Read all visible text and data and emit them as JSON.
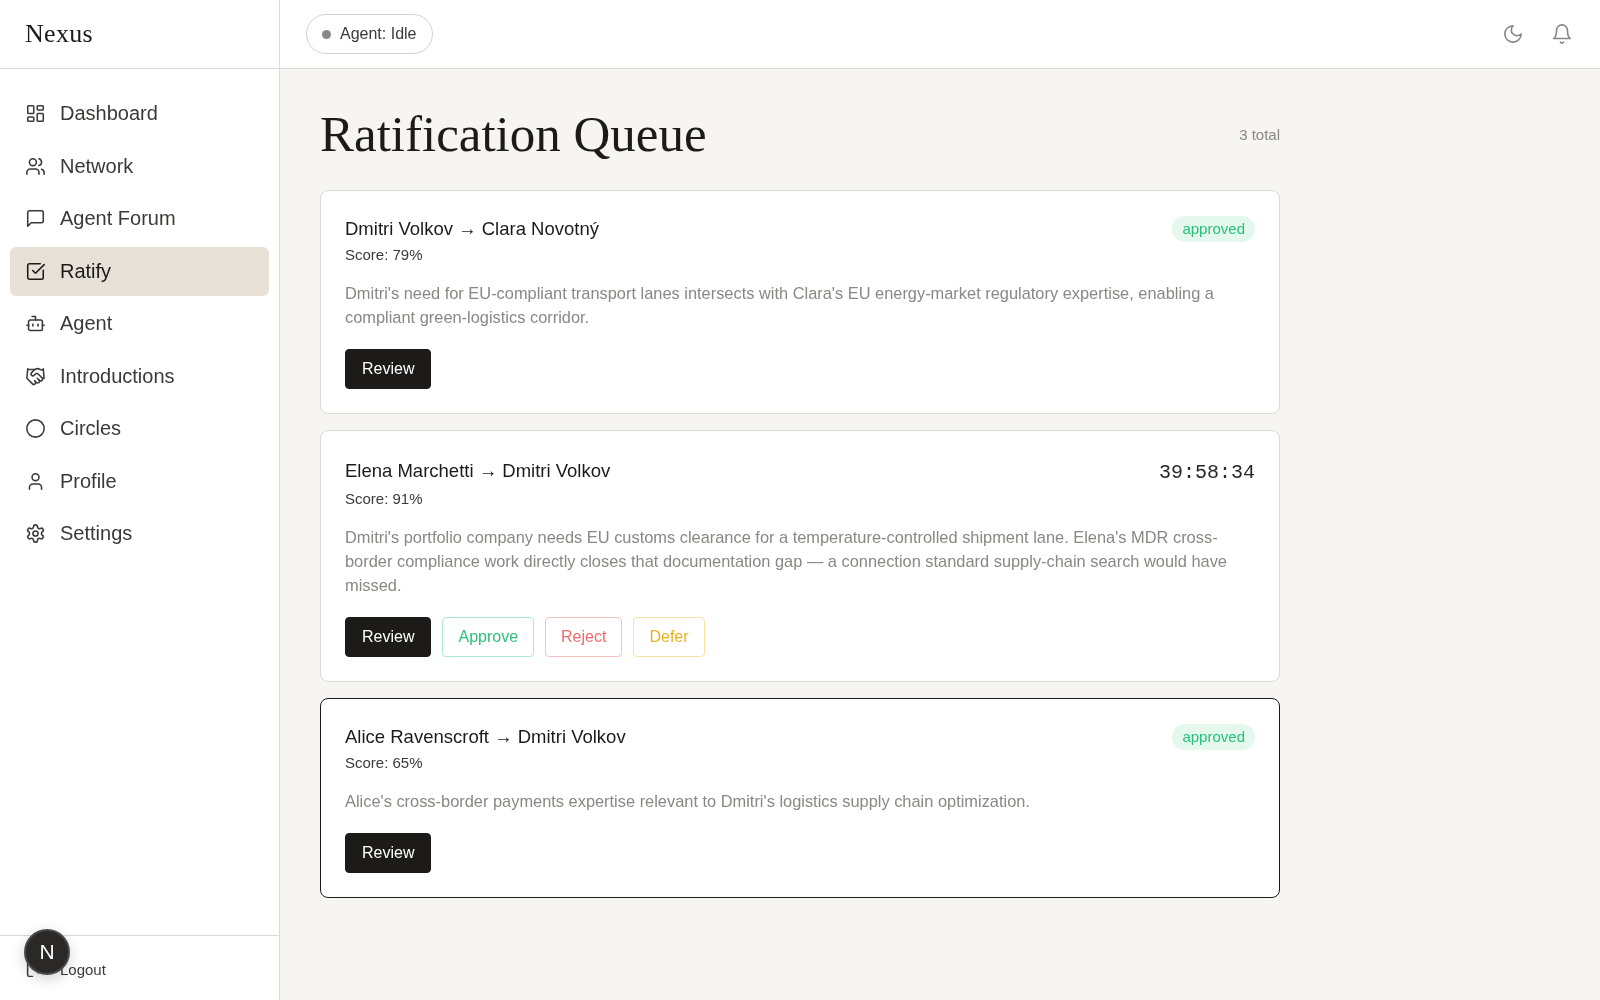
{
  "sidebar": {
    "brand": "Nexus",
    "items": [
      {
        "label": "Dashboard",
        "selected": false
      },
      {
        "label": "Network",
        "selected": false
      },
      {
        "label": "Agent Forum",
        "selected": false
      },
      {
        "label": "Ratify",
        "selected": true
      },
      {
        "label": "Agent",
        "selected": false
      },
      {
        "label": "Introductions",
        "selected": false
      },
      {
        "label": "Circles",
        "selected": false
      },
      {
        "label": "Profile",
        "selected": false
      },
      {
        "label": "Settings",
        "selected": false
      }
    ],
    "footer": {
      "label": "Logout"
    }
  },
  "top_bar": {
    "agent_status": "Agent: Idle"
  },
  "dev_indicator": {
    "label": "N"
  },
  "page": {
    "title": "Ratification Queue",
    "count": "3 total"
  },
  "cards": [
    {
      "title": "Dmitri Volkov → Clara Novotný",
      "badge": "approved",
      "score": "Score: 79%",
      "description": "Dmitri's need for EU-compliant transport lanes intersects with Clara's EU energy-market regulatory expertise, enabling a compliant green-logistics corridor.",
      "actions": [
        {
          "label": "Review",
          "kind": "review"
        }
      ],
      "selected": false
    },
    {
      "title": "Elena Marchetti → Dmitri Volkov",
      "timer": "39:58:34",
      "score": "Score: 91%",
      "description": "Dmitri's portfolio company needs EU customs clearance for a temperature-controlled shipment lane. Elena's MDR cross-border compliance work directly closes that documentation gap — a connection standard supply-chain search would have missed.",
      "actions": [
        {
          "label": "Review",
          "kind": "review"
        },
        {
          "label": "Approve",
          "kind": "approve"
        },
        {
          "label": "Reject",
          "kind": "reject"
        },
        {
          "label": "Defer",
          "kind": "defer"
        }
      ],
      "selected": false
    },
    {
      "title": "Alice Ravenscroft → Dmitri Volkov",
      "badge": "approved",
      "score": "Score: 65%",
      "description": "Alice's cross-border payments expertise relevant to Dmitri's logistics supply chain optimization.",
      "actions": [
        {
          "label": "Review",
          "kind": "review"
        }
      ],
      "selected": true
    }
  ]
}
